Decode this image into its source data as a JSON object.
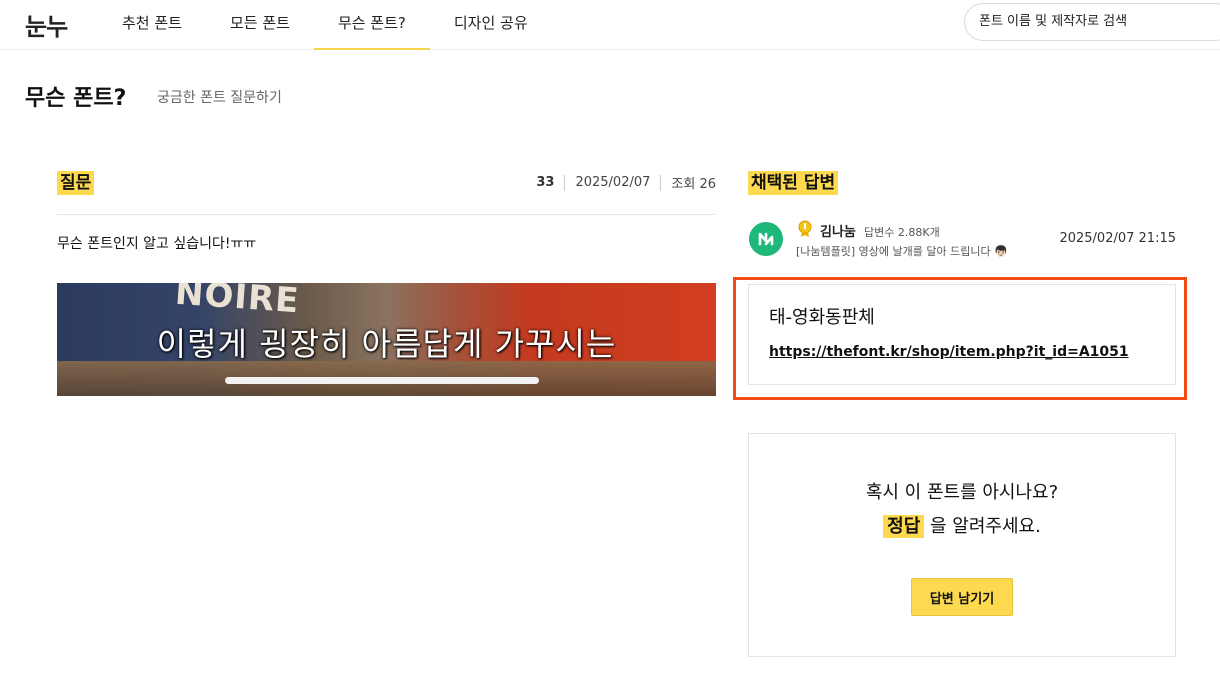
{
  "header": {
    "logo": "눈누",
    "nav": [
      {
        "label": "추천 폰트",
        "active": false
      },
      {
        "label": "모든 폰트",
        "active": false
      },
      {
        "label": "무슨 폰트?",
        "active": true
      },
      {
        "label": "디자인 공유",
        "active": false
      }
    ],
    "search_placeholder": "폰트 이름 및 제작자로 검색"
  },
  "page": {
    "title": "무슨 폰트?",
    "subtitle": "궁금한 폰트 질문하기"
  },
  "question": {
    "label": "질문",
    "count": "33",
    "date": "2025/02/07",
    "views": "조회 26",
    "text": "무슨 폰트인지 알고 싶습니다!ㅠㅠ",
    "image": {
      "sign_text": "NOIRE",
      "caption": "이렇게 굉장히 아름답게 가꾸시는"
    }
  },
  "answer": {
    "label": "채택된 답변",
    "user_name": "김나눔",
    "user_stats": "답변수 2.88K개",
    "user_bio": "[나눔템플릿] 영상에 날개를 달아 드립니다 👦🏻",
    "date": "2025/02/07 21:15",
    "font_name": "태-영화동판체",
    "font_link": "https://thefont.kr/shop/item.php?it_id=A1051"
  },
  "cta": {
    "question": "혹시 이 폰트를 아시나요?",
    "answer_highlight": "정답",
    "answer_rest": "을 알려주세요.",
    "button": "답변 남기기"
  },
  "colors": {
    "accent": "#fcd94e",
    "highlight_frame": "#ef4b12",
    "avatar": "#20b87a"
  }
}
